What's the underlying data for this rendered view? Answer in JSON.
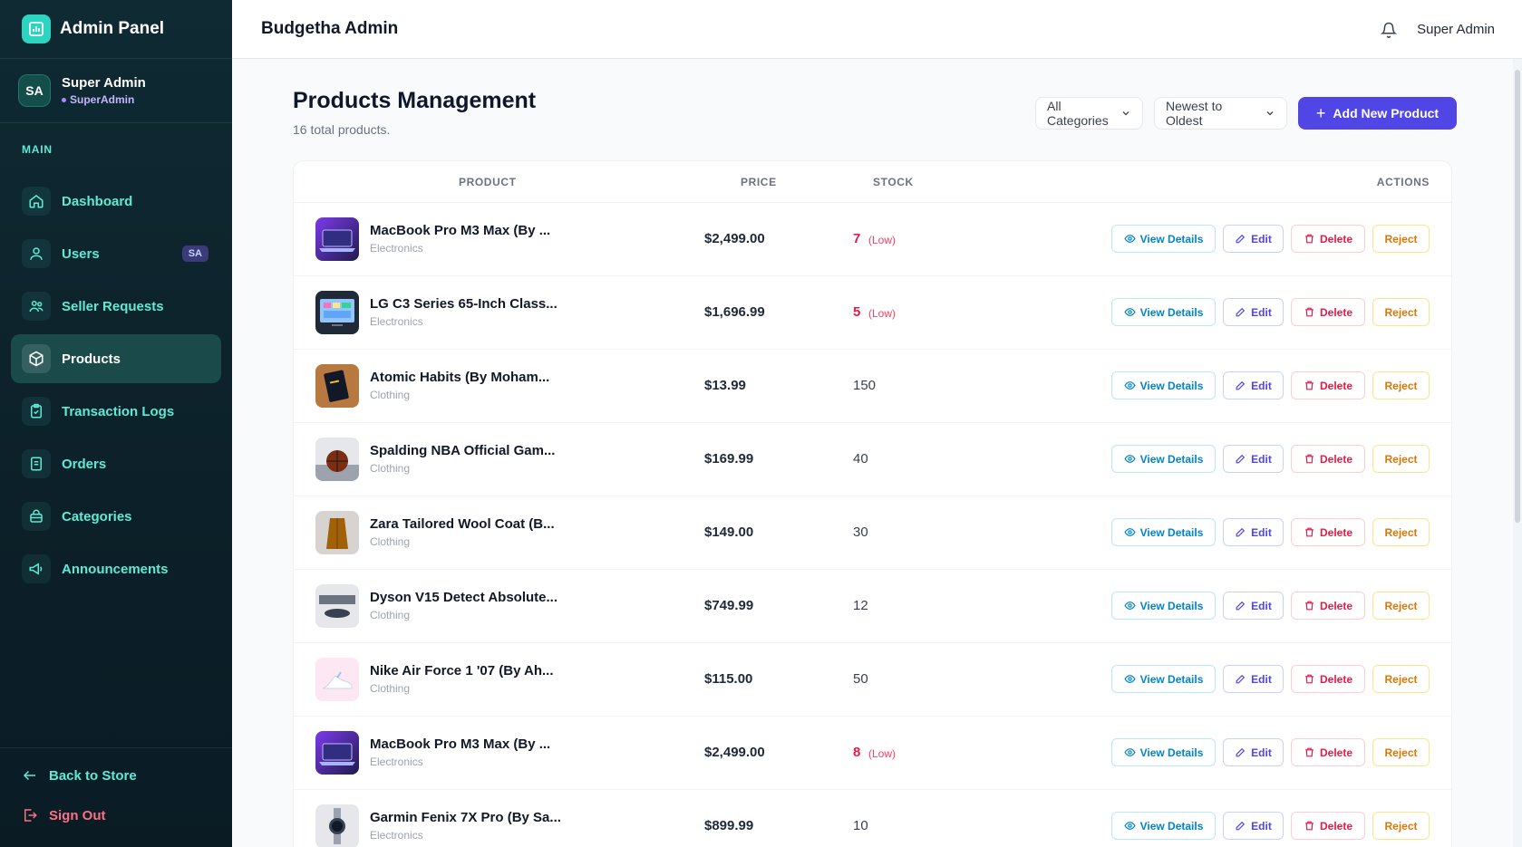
{
  "sidebar": {
    "brand_title": "Admin Panel",
    "user": {
      "initials": "SA",
      "name": "Super Admin",
      "role": "SuperAdmin"
    },
    "section_label": "MAIN",
    "items": [
      {
        "label": "Dashboard",
        "icon": "home-icon"
      },
      {
        "label": "Users",
        "icon": "users-icon",
        "badge": "SA"
      },
      {
        "label": "Seller Requests",
        "icon": "user-group-icon"
      },
      {
        "label": "Products",
        "icon": "box-icon",
        "active": true
      },
      {
        "label": "Transaction Logs",
        "icon": "clipboard-icon"
      },
      {
        "label": "Orders",
        "icon": "receipt-icon"
      },
      {
        "label": "Categories",
        "icon": "bag-icon"
      },
      {
        "label": "Announcements",
        "icon": "megaphone-icon"
      }
    ],
    "back_label": "Back to Store",
    "signout_label": "Sign Out"
  },
  "header": {
    "title": "Budgetha Admin",
    "user": "Super Admin"
  },
  "main": {
    "title": "Products Management",
    "subtitle": "16 total products.",
    "category_filter": "All Categories",
    "sort_filter": "Newest to Oldest",
    "add_button": "Add New Product"
  },
  "table": {
    "columns": {
      "product": "PRODUCT",
      "price": "PRICE",
      "stock": "STOCK",
      "actions": "ACTIONS"
    },
    "action_labels": {
      "view": "View Details",
      "edit": "Edit",
      "delete": "Delete",
      "reject": "Reject"
    },
    "low_label": "(Low)",
    "rows": [
      {
        "name": "MacBook Pro M3 Max (By ...",
        "category": "Electronics",
        "price": "$2,499.00",
        "stock": "7",
        "low": true,
        "thumb": "laptop"
      },
      {
        "name": "LG C3 Series 65-Inch Class...",
        "category": "Electronics",
        "price": "$1,696.99",
        "stock": "5",
        "low": true,
        "thumb": "tv"
      },
      {
        "name": "Atomic Habits (By Moham...",
        "category": "Clothing",
        "price": "$13.99",
        "stock": "150",
        "low": false,
        "thumb": "book"
      },
      {
        "name": "Spalding NBA Official Gam...",
        "category": "Clothing",
        "price": "$169.99",
        "stock": "40",
        "low": false,
        "thumb": "ball"
      },
      {
        "name": "Zara Tailored Wool Coat (B...",
        "category": "Clothing",
        "price": "$149.00",
        "stock": "30",
        "low": false,
        "thumb": "coat"
      },
      {
        "name": "Dyson V15 Detect Absolute...",
        "category": "Clothing",
        "price": "$749.99",
        "stock": "12",
        "low": false,
        "thumb": "vacuum"
      },
      {
        "name": "Nike Air Force 1 '07 (By Ah...",
        "category": "Clothing",
        "price": "$115.00",
        "stock": "50",
        "low": false,
        "thumb": "shoe"
      },
      {
        "name": "MacBook Pro M3 Max (By ...",
        "category": "Electronics",
        "price": "$2,499.00",
        "stock": "8",
        "low": true,
        "thumb": "laptop"
      },
      {
        "name": "Garmin Fenix 7X Pro (By Sa...",
        "category": "Electronics",
        "price": "$899.99",
        "stock": "10",
        "low": false,
        "thumb": "watch"
      }
    ]
  },
  "colors": {
    "sidebar_bg": "#0f2a33",
    "accent": "#4f46e5",
    "teal": "#5eead4",
    "low_stock": "#e11d48"
  }
}
